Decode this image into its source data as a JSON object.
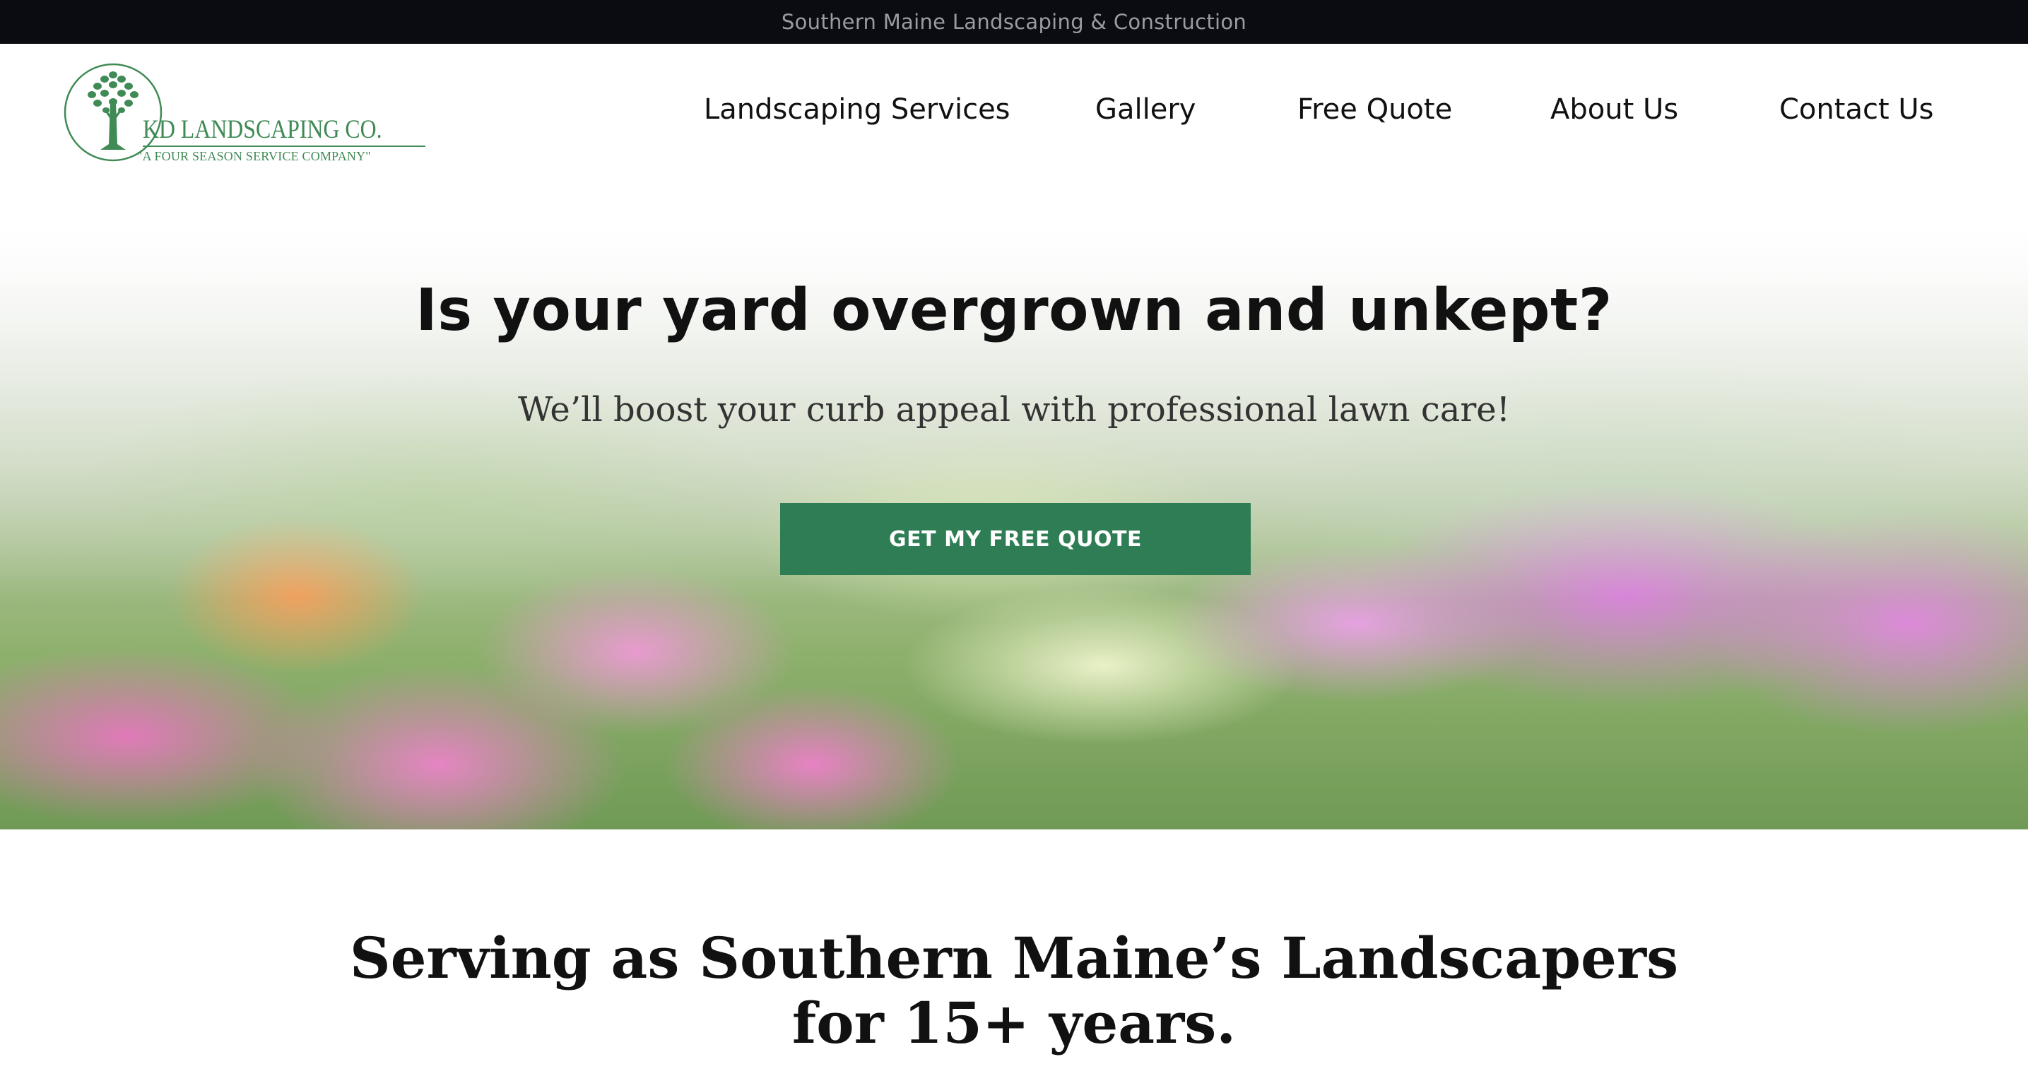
{
  "topbar": {
    "text": "Southern Maine Landscaping & Construction"
  },
  "brand": {
    "name": "KD LANDSCAPING CO.",
    "tagline": "\"A FOUR SEASON SERVICE COMPANY\"",
    "color": "#3f8a55"
  },
  "nav": {
    "items": [
      {
        "label": "Landscaping Services"
      },
      {
        "label": "Gallery"
      },
      {
        "label": "Free Quote"
      },
      {
        "label": "About Us"
      },
      {
        "label": "Contact Us"
      }
    ]
  },
  "hero": {
    "title": "Is your yard overgrown and unkept?",
    "subtitle": "We’ll boost your curb appeal with professional lawn care!",
    "cta_label": "GET MY FREE QUOTE",
    "cta_color": "#2e7d55"
  },
  "section": {
    "heading_line1": "Serving as Southern Maine’s Landscapers",
    "heading_line2": "for 15+ years."
  }
}
